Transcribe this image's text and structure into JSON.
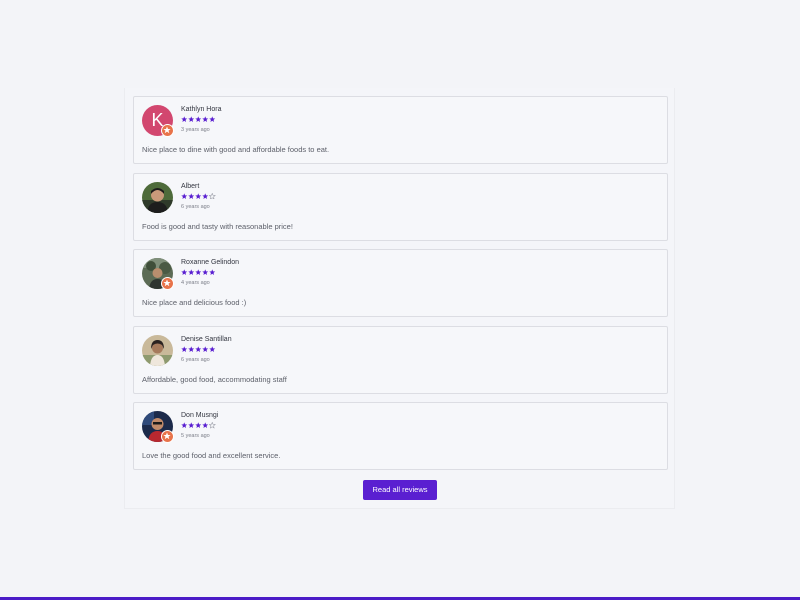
{
  "colors": {
    "accent": "#5a1fd1",
    "star": "#5a1fd1",
    "badge": "#e8734a",
    "letter_avatar": "#d2476f",
    "bottom_bar": "#4a1bc7"
  },
  "reviews": [
    {
      "name": "Kathlyn Hora",
      "rating": 5,
      "time": "3 years ago",
      "text": "Nice place to dine with good and affordable foods to eat.",
      "avatar_letter": "K",
      "badge": true
    },
    {
      "name": "Albert",
      "rating": 4,
      "time": "6 years ago",
      "text": "Food is good and tasty with reasonable price!",
      "badge": false
    },
    {
      "name": "Roxanne Gelindon",
      "rating": 5,
      "time": "4 years ago",
      "text": "Nice place and delicious food :)",
      "badge": true
    },
    {
      "name": "Denise Santillan",
      "rating": 5,
      "time": "6 years ago",
      "text": "Affordable, good food, accommodating staff",
      "badge": false
    },
    {
      "name": "Don Musngi",
      "rating": 4,
      "time": "5 years ago",
      "text": "Love the good food and excellent service.",
      "badge": true
    }
  ],
  "read_all": {
    "label": "Read all reviews"
  }
}
